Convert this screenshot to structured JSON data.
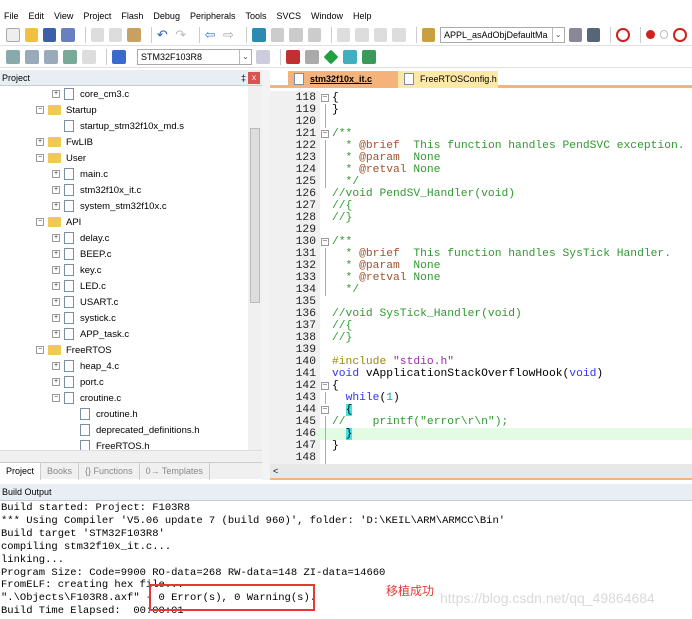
{
  "menu": [
    "File",
    "Edit",
    "View",
    "Project",
    "Flash",
    "Debug",
    "Peripherals",
    "Tools",
    "SVCS",
    "Window",
    "Help"
  ],
  "toolbar1": {
    "find_combo": "APPL_asAdObjDefaultMa"
  },
  "toolbar2": {
    "target_combo": "STM32F103R8"
  },
  "project_panel": {
    "title": "Project",
    "pin": "‡",
    "close": "x",
    "tree": [
      {
        "label": "core_cm3.c",
        "type": "file",
        "level": 2,
        "exp": "+"
      },
      {
        "label": "Startup",
        "type": "folder",
        "level": 1,
        "exp": "-"
      },
      {
        "label": "startup_stm32f10x_md.s",
        "type": "file",
        "level": 2,
        "exp": ""
      },
      {
        "label": "FwLIB",
        "type": "folder",
        "level": 1,
        "exp": "+"
      },
      {
        "label": "User",
        "type": "folder",
        "level": 1,
        "exp": "-"
      },
      {
        "label": "main.c",
        "type": "file",
        "level": 2,
        "exp": "+"
      },
      {
        "label": "stm32f10x_it.c",
        "type": "file",
        "level": 2,
        "exp": "+"
      },
      {
        "label": "system_stm32f10x.c",
        "type": "file",
        "level": 2,
        "exp": "+"
      },
      {
        "label": "API",
        "type": "folder",
        "level": 1,
        "exp": "-"
      },
      {
        "label": "delay.c",
        "type": "file",
        "level": 2,
        "exp": "+"
      },
      {
        "label": "BEEP.c",
        "type": "file",
        "level": 2,
        "exp": "+"
      },
      {
        "label": "key.c",
        "type": "file",
        "level": 2,
        "exp": "+"
      },
      {
        "label": "LED.c",
        "type": "file",
        "level": 2,
        "exp": "+"
      },
      {
        "label": "USART.c",
        "type": "file",
        "level": 2,
        "exp": "+"
      },
      {
        "label": "systick.c",
        "type": "file",
        "level": 2,
        "exp": "+"
      },
      {
        "label": "APP_task.c",
        "type": "file",
        "level": 2,
        "exp": "+"
      },
      {
        "label": "FreeRTOS",
        "type": "folder",
        "level": 1,
        "exp": "-"
      },
      {
        "label": "heap_4.c",
        "type": "file",
        "level": 2,
        "exp": "+"
      },
      {
        "label": "port.c",
        "type": "file",
        "level": 2,
        "exp": "+"
      },
      {
        "label": "croutine.c",
        "type": "file",
        "level": 2,
        "exp": "-"
      },
      {
        "label": "croutine.h",
        "type": "file",
        "level": 3,
        "exp": ""
      },
      {
        "label": "deprecated_definitions.h",
        "type": "file",
        "level": 3,
        "exp": ""
      },
      {
        "label": "FreeRTOS.h",
        "type": "file",
        "level": 3,
        "exp": ""
      }
    ],
    "tabs": [
      "Project",
      "Books",
      "{} Functions",
      "0→ Templates"
    ]
  },
  "editor": {
    "tabs": [
      "stm32f10x_it.c",
      "FreeRTOSConfig.h"
    ],
    "active_tab": 0,
    "lines": [
      {
        "n": "118",
        "f": "box",
        "s": [
          [
            "{",
            ""
          ]
        ]
      },
      {
        "n": "119",
        "f": "line",
        "s": [
          [
            "}",
            ""
          ]
        ]
      },
      {
        "n": "120",
        "f": "line",
        "s": []
      },
      {
        "n": "121",
        "f": "box",
        "s": [
          [
            "/**",
            "c-com"
          ]
        ]
      },
      {
        "n": "122",
        "f": "line",
        "s": [
          [
            "  * ",
            "c-com"
          ],
          [
            "@brief",
            "c-tag"
          ],
          [
            "  This function handles PendSVC exception.",
            "c-com"
          ]
        ]
      },
      {
        "n": "123",
        "f": "line",
        "s": [
          [
            "  * ",
            "c-com"
          ],
          [
            "@param",
            "c-tag"
          ],
          [
            "  None",
            "c-com"
          ]
        ]
      },
      {
        "n": "124",
        "f": "line",
        "s": [
          [
            "  * ",
            "c-com"
          ],
          [
            "@retval",
            "c-tag"
          ],
          [
            " None",
            "c-com"
          ]
        ]
      },
      {
        "n": "125",
        "f": "line",
        "s": [
          [
            "  */",
            "c-com"
          ]
        ]
      },
      {
        "n": "126",
        "f": "",
        "s": [
          [
            "//void PendSV_Handler(void)",
            "c-com"
          ]
        ]
      },
      {
        "n": "127",
        "f": "",
        "s": [
          [
            "//{",
            "c-com"
          ]
        ]
      },
      {
        "n": "128",
        "f": "",
        "s": [
          [
            "//}",
            "c-com"
          ]
        ]
      },
      {
        "n": "129",
        "f": "",
        "s": []
      },
      {
        "n": "130",
        "f": "box",
        "s": [
          [
            "/**",
            "c-com"
          ]
        ]
      },
      {
        "n": "131",
        "f": "line",
        "s": [
          [
            "  * ",
            "c-com"
          ],
          [
            "@brief",
            "c-tag"
          ],
          [
            "  This function handles SysTick Handler.",
            "c-com"
          ]
        ]
      },
      {
        "n": "132",
        "f": "line",
        "s": [
          [
            "  * ",
            "c-com"
          ],
          [
            "@param",
            "c-tag"
          ],
          [
            "  None",
            "c-com"
          ]
        ]
      },
      {
        "n": "133",
        "f": "line",
        "s": [
          [
            "  * ",
            "c-com"
          ],
          [
            "@retval",
            "c-tag"
          ],
          [
            " None",
            "c-com"
          ]
        ]
      },
      {
        "n": "134",
        "f": "line",
        "s": [
          [
            "  */",
            "c-com"
          ]
        ]
      },
      {
        "n": "135",
        "f": "",
        "s": []
      },
      {
        "n": "136",
        "f": "",
        "s": [
          [
            "//void SysTick_Handler(void)",
            "c-com"
          ]
        ]
      },
      {
        "n": "137",
        "f": "",
        "s": [
          [
            "//{",
            "c-com"
          ]
        ]
      },
      {
        "n": "138",
        "f": "",
        "s": [
          [
            "//}",
            "c-com"
          ]
        ]
      },
      {
        "n": "139",
        "f": "",
        "s": []
      },
      {
        "n": "140",
        "f": "",
        "s": [
          [
            "#include ",
            "c-pp"
          ],
          [
            "\"stdio.h\"",
            "c-str"
          ]
        ]
      },
      {
        "n": "141",
        "f": "",
        "s": [
          [
            "void",
            "c-kw"
          ],
          [
            " vApplicationStackOverflowHook(",
            ""
          ],
          [
            "void",
            "c-kw"
          ],
          [
            ")",
            ""
          ]
        ]
      },
      {
        "n": "142",
        "f": "box",
        "s": [
          [
            "{",
            ""
          ]
        ]
      },
      {
        "n": "143",
        "f": "line",
        "s": [
          [
            "  ",
            ""
          ],
          [
            "while",
            "c-kw"
          ],
          [
            "(",
            ""
          ],
          [
            "1",
            "c-num"
          ],
          [
            ")",
            ""
          ]
        ]
      },
      {
        "n": "144",
        "f": "box",
        "s": [
          [
            "  ",
            ""
          ],
          [
            "{",
            "c-br"
          ]
        ]
      },
      {
        "n": "145",
        "f": "line",
        "s": [
          [
            "//    printf(\"error\\r\\n\");",
            "c-com"
          ]
        ]
      },
      {
        "n": "146",
        "f": "line",
        "hl": true,
        "s": [
          [
            "  ",
            ""
          ],
          [
            "}",
            "c-br"
          ]
        ]
      },
      {
        "n": "147",
        "f": "line",
        "s": [
          [
            "}",
            ""
          ]
        ]
      },
      {
        "n": "148",
        "f": "line",
        "s": []
      }
    ]
  },
  "build_output": {
    "title": "Build Output",
    "lines": [
      "Build started: Project: F103R8",
      "*** Using Compiler 'V5.06 update 7 (build 960)', folder: 'D:\\KEIL\\ARM\\ARMCC\\Bin'",
      "Build target 'STM32F103R8'",
      "compiling stm32f10x_it.c...",
      "linking...",
      "Program Size: Code=9900 RO-data=268 RW-data=148 ZI-data=14660",
      "FromELF: creating hex file...",
      "\".\\Objects\\F103R8.axf\" - 0 Error(s), 0 Warning(s).",
      "Build Time Elapsed:  00:00:01"
    ],
    "annotation": "移植成功",
    "watermark": "https://blog.csdn.net/qq_49864684",
    "highlight_color": "#e53935"
  }
}
